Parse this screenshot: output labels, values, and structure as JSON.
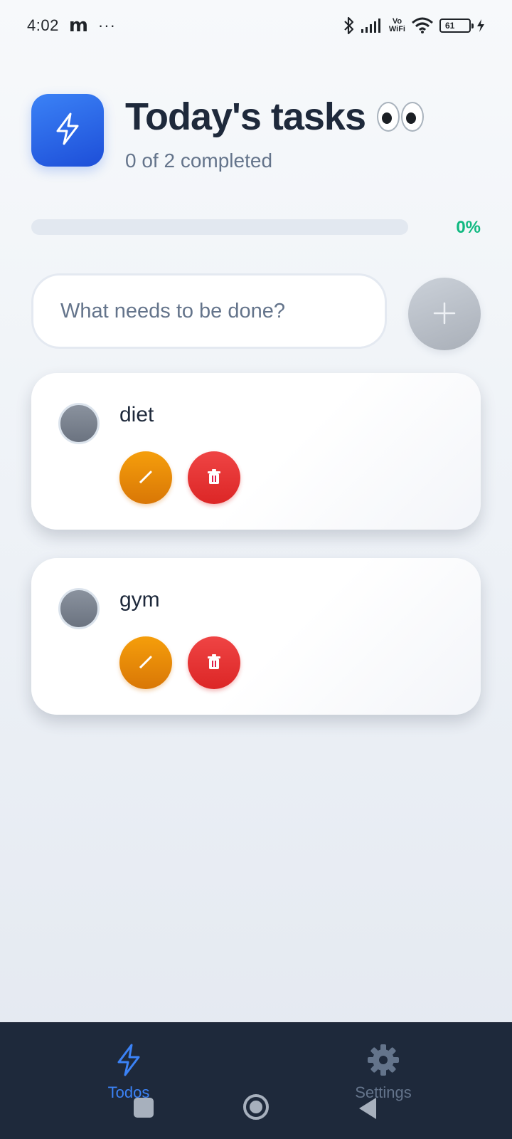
{
  "status_bar": {
    "time": "4:02",
    "app_glyph": "m",
    "more_dots": "···",
    "vo": "Vo",
    "wifi_label": "WiFi",
    "battery_level": "61"
  },
  "header": {
    "title": "Today's tasks",
    "subtitle": "0 of 2 completed",
    "icon": "lightning-icon",
    "emoji": "eyes"
  },
  "progress": {
    "percent": 0,
    "label": "0%"
  },
  "new_task": {
    "placeholder": "What needs to be done?",
    "value": "",
    "add_icon": "plus-icon"
  },
  "tasks": [
    {
      "title": "diet",
      "completed": false
    },
    {
      "title": "gym",
      "completed": false
    }
  ],
  "nav": {
    "tabs": [
      {
        "label": "Todos",
        "icon": "lightning-icon",
        "active": true
      },
      {
        "label": "Settings",
        "icon": "gear-icon",
        "active": false
      }
    ]
  },
  "colors": {
    "accent": "#3b82f6",
    "success": "#10b981",
    "edit": "#f59e0b",
    "delete": "#ef4444",
    "nav_bg": "#1e293b"
  }
}
